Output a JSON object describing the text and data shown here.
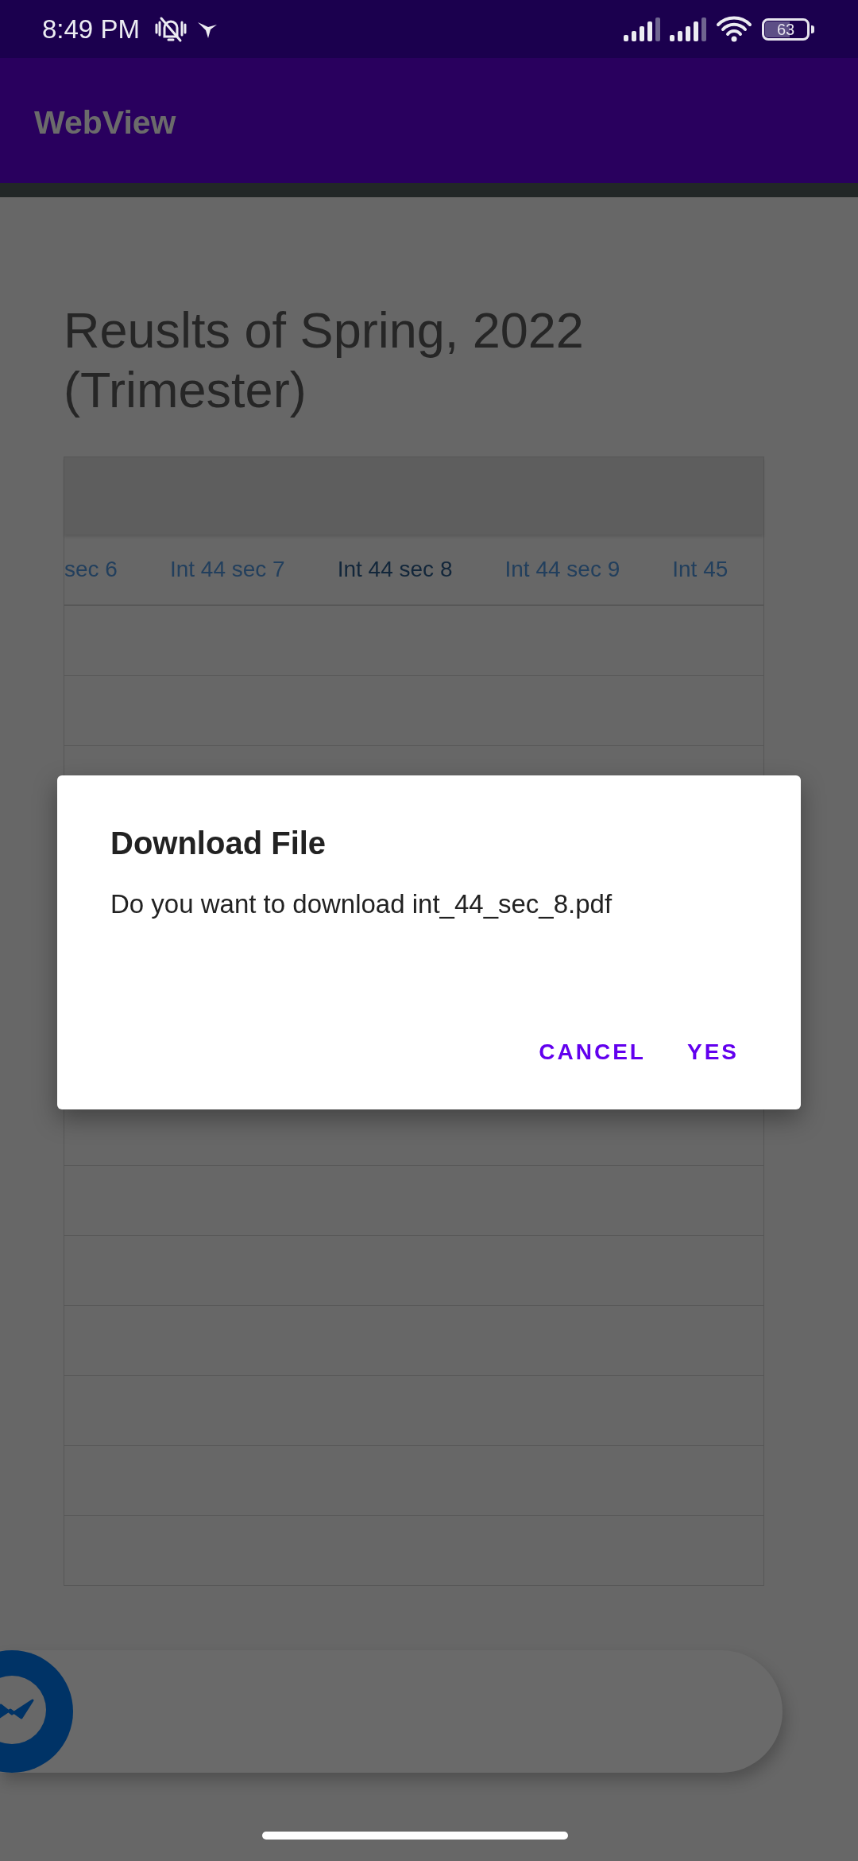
{
  "status_bar": {
    "time": "8:49 PM",
    "battery": "63"
  },
  "app_bar": {
    "title": "WebView"
  },
  "page": {
    "heading": "Reuslts of Spring, 2022 (Trimester)"
  },
  "table": {
    "columns": [
      {
        "label": "sec 6",
        "selected": false
      },
      {
        "label": "Int 44 sec 7",
        "selected": false
      },
      {
        "label": "Int 44 sec 8",
        "selected": true
      },
      {
        "label": "Int 44 sec 9",
        "selected": false
      },
      {
        "label": "Int 45",
        "selected": false
      }
    ]
  },
  "dialog": {
    "title": "Download File",
    "message": "Do you want to download int_44_sec_8.pdf",
    "buttons": [
      "CANCEL",
      "YES"
    ]
  }
}
